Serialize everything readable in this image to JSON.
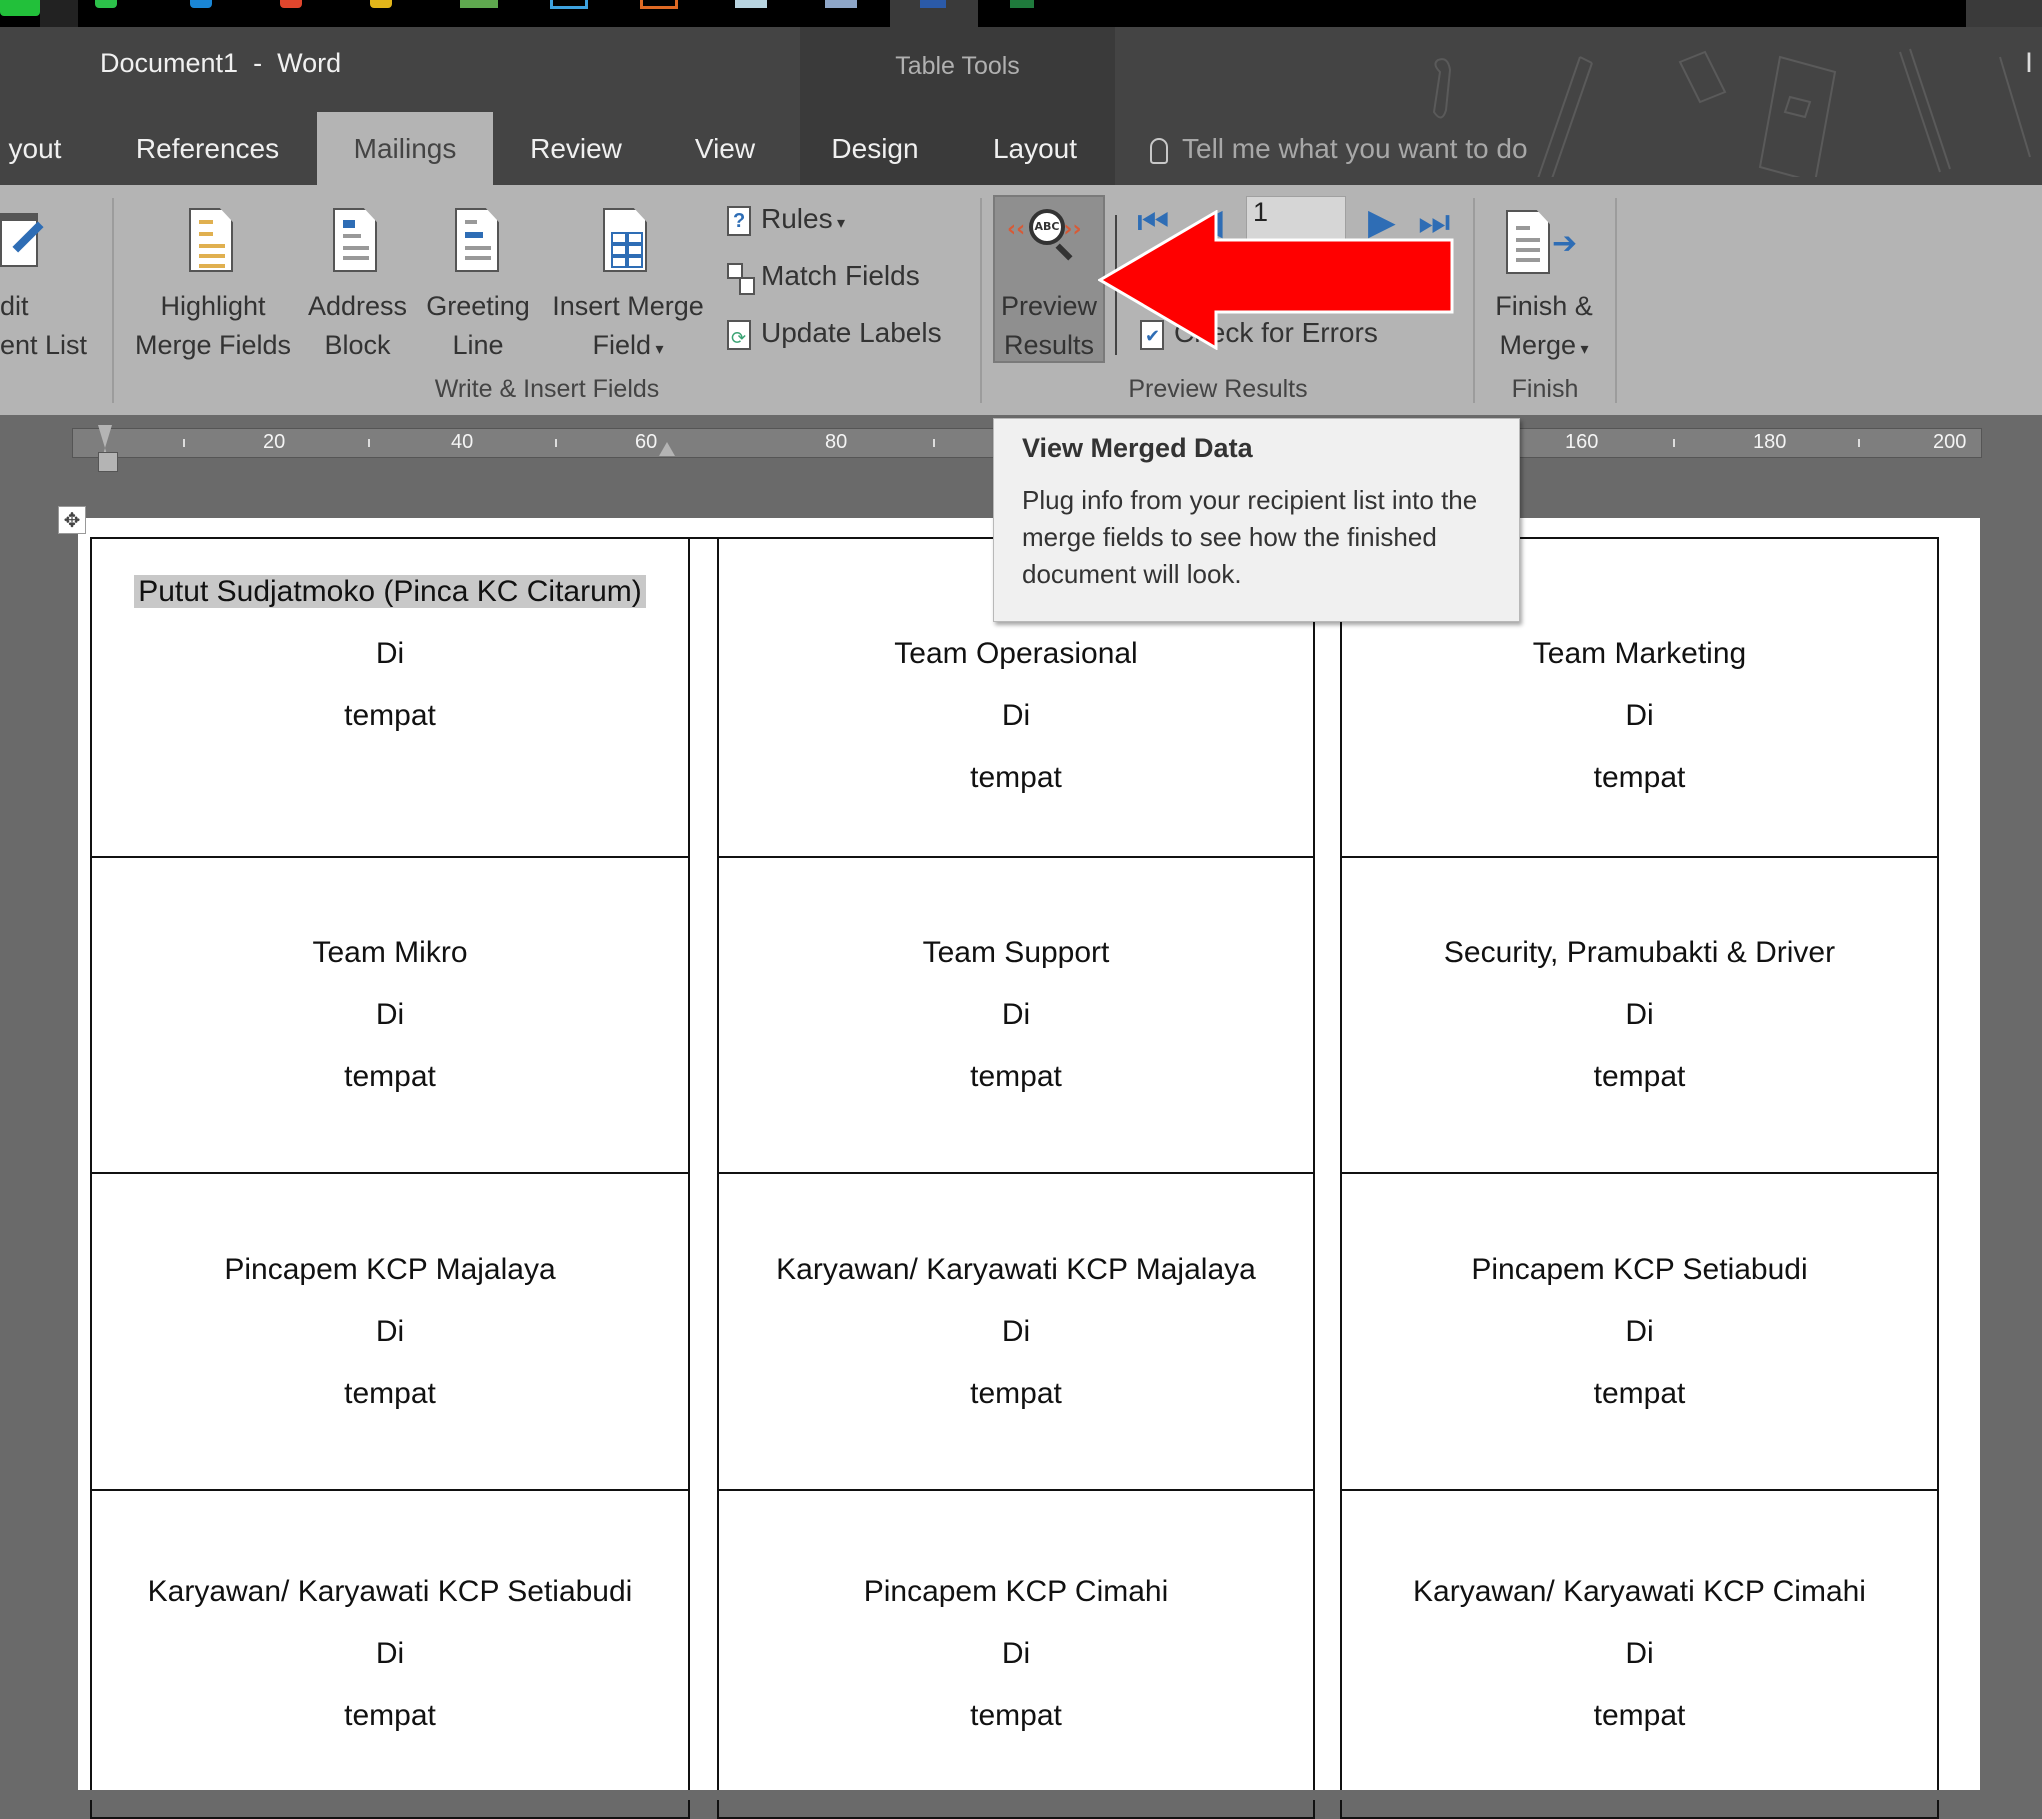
{
  "window": {
    "title": "Document1  -  Word",
    "context_group": "Table Tools",
    "edge_text": "I"
  },
  "taskbar": {
    "icons": [
      "app-icon-green",
      "whatsapp-icon",
      "blue-app-icon",
      "red-app-icon",
      "chrome-icon",
      "green-app-icon",
      "blue-outline-app-icon",
      "orange-app-icon",
      "image-viewer-icon",
      "printer-icon",
      "word-icon",
      "excel-icon"
    ]
  },
  "tabs": [
    {
      "label": "yout",
      "active": false
    },
    {
      "label": "References",
      "active": false
    },
    {
      "label": "Mailings",
      "active": true
    },
    {
      "label": "Review",
      "active": false
    },
    {
      "label": "View",
      "active": false
    },
    {
      "label": "Design",
      "active": false
    },
    {
      "label": "Layout",
      "active": false
    }
  ],
  "tell_me": {
    "placeholder": "Tell me what you want to do"
  },
  "ribbon": {
    "edit_recipient": {
      "line1": "dit",
      "line2": "ent List"
    },
    "write_insert": {
      "group_label": "Write & Insert Fields",
      "highlight": {
        "line1": "Highlight",
        "line2": "Merge Fields"
      },
      "address_block": {
        "line1": "Address",
        "line2": "Block"
      },
      "greeting_line": {
        "line1": "Greeting",
        "line2": "Line"
      },
      "insert_merge_field": {
        "line1": "Insert Merge",
        "line2": "Field"
      },
      "rules": "Rules",
      "match_fields": "Match Fields",
      "update_labels": "Update Labels"
    },
    "preview": {
      "group_label": "Preview Results",
      "preview_results": {
        "line1": "Preview",
        "line2": "Results"
      },
      "record_value": "1",
      "check_errors": "Check for Errors"
    },
    "finish": {
      "group_label": "Finish",
      "finish_merge": {
        "line1": "Finish &",
        "line2": "Merge"
      }
    }
  },
  "ruler": {
    "labels": [
      "20",
      "40",
      "60",
      "80",
      "160",
      "180",
      "200"
    ]
  },
  "tooltip": {
    "title": "View Merged Data",
    "body": "Plug info from your recipient list into the merge fields to see how the finished document will look."
  },
  "document": {
    "labels": [
      {
        "name": "Putut Sudjatmoko (Pinca KC Citarum)",
        "line2": "Di",
        "line3": "tempat",
        "highlighted": true
      },
      {
        "name": "Team Operasional",
        "line2": "Di",
        "line3": "tempat"
      },
      {
        "name": "Team Marketing",
        "line2": "Di",
        "line3": "tempat"
      },
      {
        "name": "Team Mikro",
        "line2": "Di",
        "line3": "tempat"
      },
      {
        "name": "Team Support",
        "line2": "Di",
        "line3": "tempat"
      },
      {
        "name": "Security, Pramubakti & Driver",
        "line2": "Di",
        "line3": "tempat"
      },
      {
        "name": "Pincapem KCP Majalaya",
        "line2": "Di",
        "line3": "tempat"
      },
      {
        "name": "Karyawan/ Karyawati KCP Majalaya",
        "line2": "Di",
        "line3": "tempat"
      },
      {
        "name": "Pincapem KCP Setiabudi",
        "line2": "Di",
        "line3": "tempat"
      },
      {
        "name": "Karyawan/ Karyawati KCP Setiabudi",
        "line2": "Di",
        "line3": "tempat"
      },
      {
        "name": "Pincapem KCP Cimahi",
        "line2": "Di",
        "line3": "tempat"
      },
      {
        "name": "Karyawan/ Karyawati KCP Cimahi",
        "line2": "Di",
        "line3": "tempat"
      }
    ]
  },
  "colors": {
    "title_bar": "#444444",
    "ribbon": "#b4b4b4",
    "annotation_arrow": "#ff0000",
    "nav_blue": "#2e6db5"
  }
}
